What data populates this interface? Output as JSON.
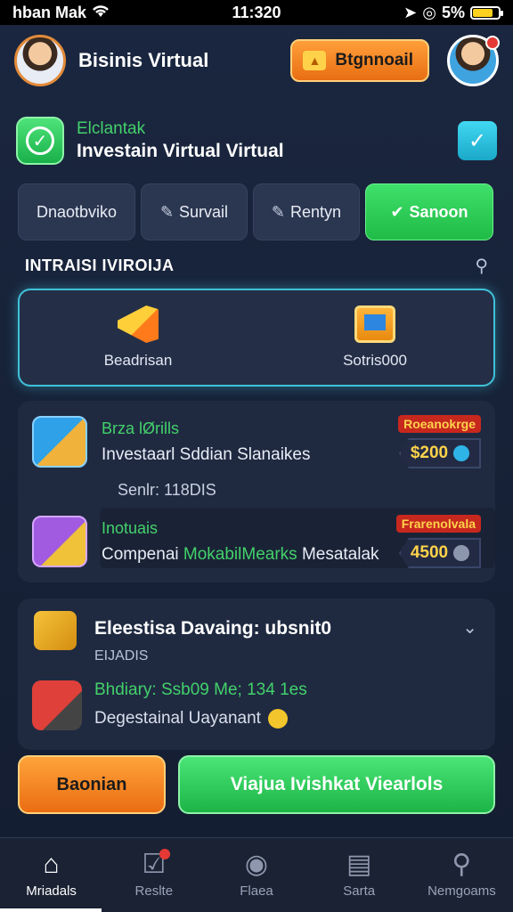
{
  "status_bar": {
    "carrier": "hban Mak",
    "time": "11:320",
    "battery": "5%"
  },
  "header": {
    "title": "Bisinis Virtual",
    "button_label": "Btgnnoail"
  },
  "banner": {
    "subtitle": "Elclantak",
    "title": "Investain Virtual Virtual"
  },
  "tabs": [
    {
      "label": "Dnaotbviko",
      "icon": ""
    },
    {
      "label": "Survail",
      "icon": "pencil-icon"
    },
    {
      "label": "Rentyn",
      "icon": "pencil-icon"
    },
    {
      "label": "Sanoon",
      "icon": "check-icon",
      "active": true
    }
  ],
  "section": {
    "title": "INTRAISI IVIROIJA"
  },
  "features": [
    {
      "label": "Beadrisan",
      "icon": "megaphone-icon"
    },
    {
      "label": "Sotris000",
      "icon": "screen-icon"
    }
  ],
  "listings": [
    {
      "category": "Brza lØrills",
      "description": "Investaarl Sddian Slanaikes",
      "tag": "Roeanokrge",
      "amount": "$200"
    },
    {
      "category": "Inotuais",
      "description_prefix": "Compenai",
      "description_highlight": "MokabilMearks",
      "description_suffix": "Mesatalak",
      "tag": "Frarenolvala",
      "amount": "4500"
    }
  ],
  "listing_meta": "Senlr: 118DIS",
  "detail": {
    "title": "Eleestisa Davaing: ubsnit0",
    "code": "EIJADIS",
    "stats": "Bhdiary: Ssb09 Me; 134 1es",
    "note": "Degestainal Uayanant"
  },
  "actions": {
    "secondary": "Baonian",
    "primary": "Viajua Ivishkat Viearlols"
  },
  "bottom_nav": [
    {
      "label": "Mriadals",
      "icon": "home-icon",
      "active": true
    },
    {
      "label": "Reslte",
      "icon": "checkbox-icon",
      "badge": true
    },
    {
      "label": "Flaea",
      "icon": "circle-icon"
    },
    {
      "label": "Sarta",
      "icon": "book-icon"
    },
    {
      "label": "Nemgoams",
      "icon": "search-person-icon"
    }
  ],
  "colors": {
    "accent_green": "#43d16a",
    "accent_orange": "#ea6d12",
    "accent_cyan": "#3fc1d8",
    "price_gold": "#ffd34a"
  }
}
